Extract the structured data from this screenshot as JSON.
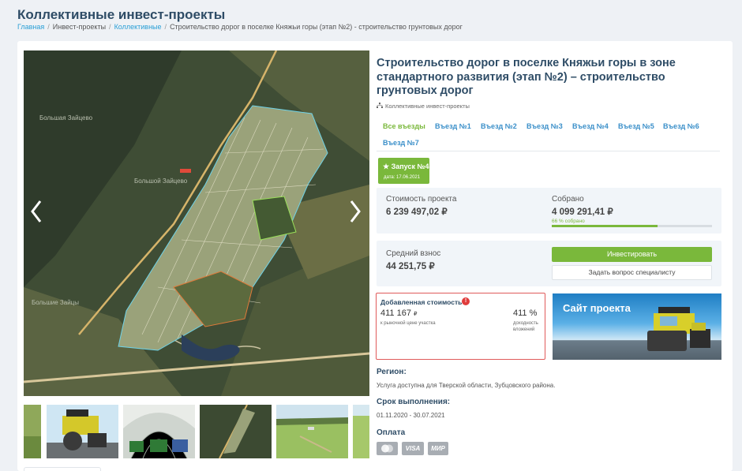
{
  "page": {
    "title": "Коллективные инвест-проекты",
    "breadcrumb": [
      "Главная",
      "Инвест-проекты",
      "Коллективные",
      "Строительство дорог в поселке Княжьи горы (этап №2) - строительство грунтовых дорог"
    ]
  },
  "gallery": {
    "map_labels": [
      "Большая Зайцево",
      "Большой Зайцево",
      "Большие Зайцы"
    ]
  },
  "project": {
    "title": "Строительство дорог в поселке Княжьи горы в зоне стандартного развития (этап №2) – строительство грунтовых дорог",
    "category": "Коллективные инвест-проекты",
    "category_icon": "org-structure-icon",
    "tabs": [
      "Все въезды",
      "Въезд №1",
      "Въезд №2",
      "Въезд №3",
      "Въезд №4",
      "Въезд №5",
      "Въезд №6",
      "Въезд №7"
    ],
    "launch": {
      "label": "Запуск №4",
      "date": "дата: 17.06.2021"
    },
    "cost_label": "Стоимость проекта",
    "cost_value": "6 239 497,02 ₽",
    "collected_label": "Собрано",
    "collected_value": "4 099 291,41 ₽",
    "progress_text": "66 % собрано",
    "progress_percent": 66,
    "avg_label": "Средний взнос",
    "avg_value": "44 251,75 ₽",
    "invest_button": "Инвестировать",
    "ask_button": "Задать вопрос специалисту",
    "added": {
      "title": "Добавленная стоимость",
      "amount": "411 167",
      "currency": "₽",
      "amount_caption": "к рыночной цене участка",
      "percent": "411 %",
      "percent_caption": "доходность вложений"
    },
    "site_banner": "Сайт проекта",
    "region_label": "Регион:",
    "region_text": "Услуга доступна для Тверской области, Зубцовского района.",
    "term_label": "Срок выполнения:",
    "term_text": "01.11.2020 - 30.07.2021",
    "payment_label": "Оплата",
    "payment_methods": [
      "MasterCard",
      "VISA",
      "МИР"
    ]
  },
  "colors": {
    "accent_green": "#7ab83b",
    "link_blue": "#2a9fd6",
    "title_navy": "#2e4c66",
    "alert_red": "#e05a5a"
  }
}
